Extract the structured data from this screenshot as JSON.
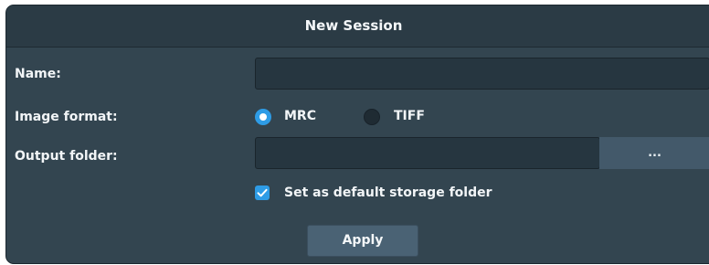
{
  "dialog": {
    "title": "New Session"
  },
  "form": {
    "name_label": "Name:",
    "name_value": "",
    "image_format_label": "Image format:",
    "image_format_options": [
      {
        "label": "MRC",
        "selected": true
      },
      {
        "label": "TIFF",
        "selected": false
      }
    ],
    "output_folder_label": "Output folder:",
    "output_folder_value": "",
    "browse_label": "...",
    "default_storage_label": "Set as default storage folder",
    "default_storage_checked": true,
    "apply_label": "Apply"
  },
  "colors": {
    "background": "#334550",
    "titlebar": "#2b3b45",
    "field": "#263640",
    "accent": "#2e9ce6",
    "button": "#4a6274"
  },
  "icons": {
    "checkbox": "checkmark-icon",
    "radio_selected": "radio-selected-icon",
    "radio_unselected": "radio-unselected-icon"
  }
}
